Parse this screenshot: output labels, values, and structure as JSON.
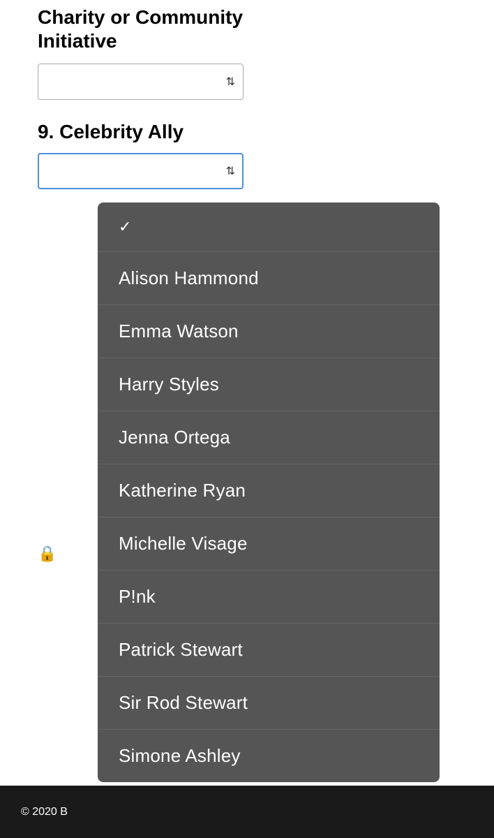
{
  "page": {
    "background_color": "#ffffff"
  },
  "top_section": {
    "title_line1": "Charity or Community",
    "title_line2": "Initiative",
    "select_placeholder": ""
  },
  "question9": {
    "label": "9. Celebrity Ally",
    "select_placeholder": ""
  },
  "dropdown": {
    "items": [
      {
        "id": "alison-hammond",
        "label": "Alison Hammond"
      },
      {
        "id": "emma-watson",
        "label": "Emma Watson"
      },
      {
        "id": "harry-styles",
        "label": "Harry Styles"
      },
      {
        "id": "jenna-ortega",
        "label": "Jenna Ortega"
      },
      {
        "id": "katherine-ryan",
        "label": "Katherine Ryan"
      },
      {
        "id": "michelle-visage",
        "label": "Michelle Visage"
      },
      {
        "id": "pink",
        "label": "P!nk"
      },
      {
        "id": "patrick-stewart",
        "label": "Patrick Stewart"
      },
      {
        "id": "sir-rod-stewart",
        "label": "Sir Rod Stewart"
      },
      {
        "id": "simone-ashley",
        "label": "Simone Ashley"
      }
    ]
  },
  "footer": {
    "copyright": "© 2020 B"
  }
}
